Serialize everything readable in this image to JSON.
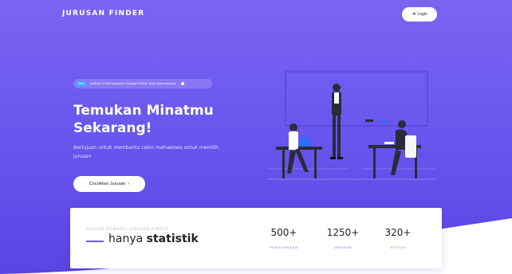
{
  "header": {
    "brand": "JURUSAN FINDER",
    "login_label": "Login",
    "login_icon": "login-icon"
  },
  "hero": {
    "badge_tag": "New",
    "badge_text": "Aplikasi Ini Menyediakan Sebagai Pilihan Acak Rekomendasi",
    "title_line1": "Temukan Minatmu",
    "title_line2": "Sekarang!",
    "description": "Bertujuan untuk membantu calon mahasiswa untuk memilih jurusan",
    "cta_label": "Cocokkan Jurusan",
    "cta_arrow": "›"
  },
  "stats": {
    "eyebrow": "ALASAN MEMAKAI JURUSAN FINDER",
    "heading_prefix": "hanya",
    "heading_bold": "statistik",
    "items": [
      {
        "value": "500+",
        "label": "PENGGUNAAN"
      },
      {
        "value": "1250+",
        "label": "JURUSAN"
      },
      {
        "value": "320+",
        "label": "SETUJU"
      }
    ]
  },
  "colors": {
    "hero_top": "#7a64f2",
    "hero_bottom": "#5a44e4",
    "accent": "#6a57ee",
    "card": "#ffffff"
  }
}
